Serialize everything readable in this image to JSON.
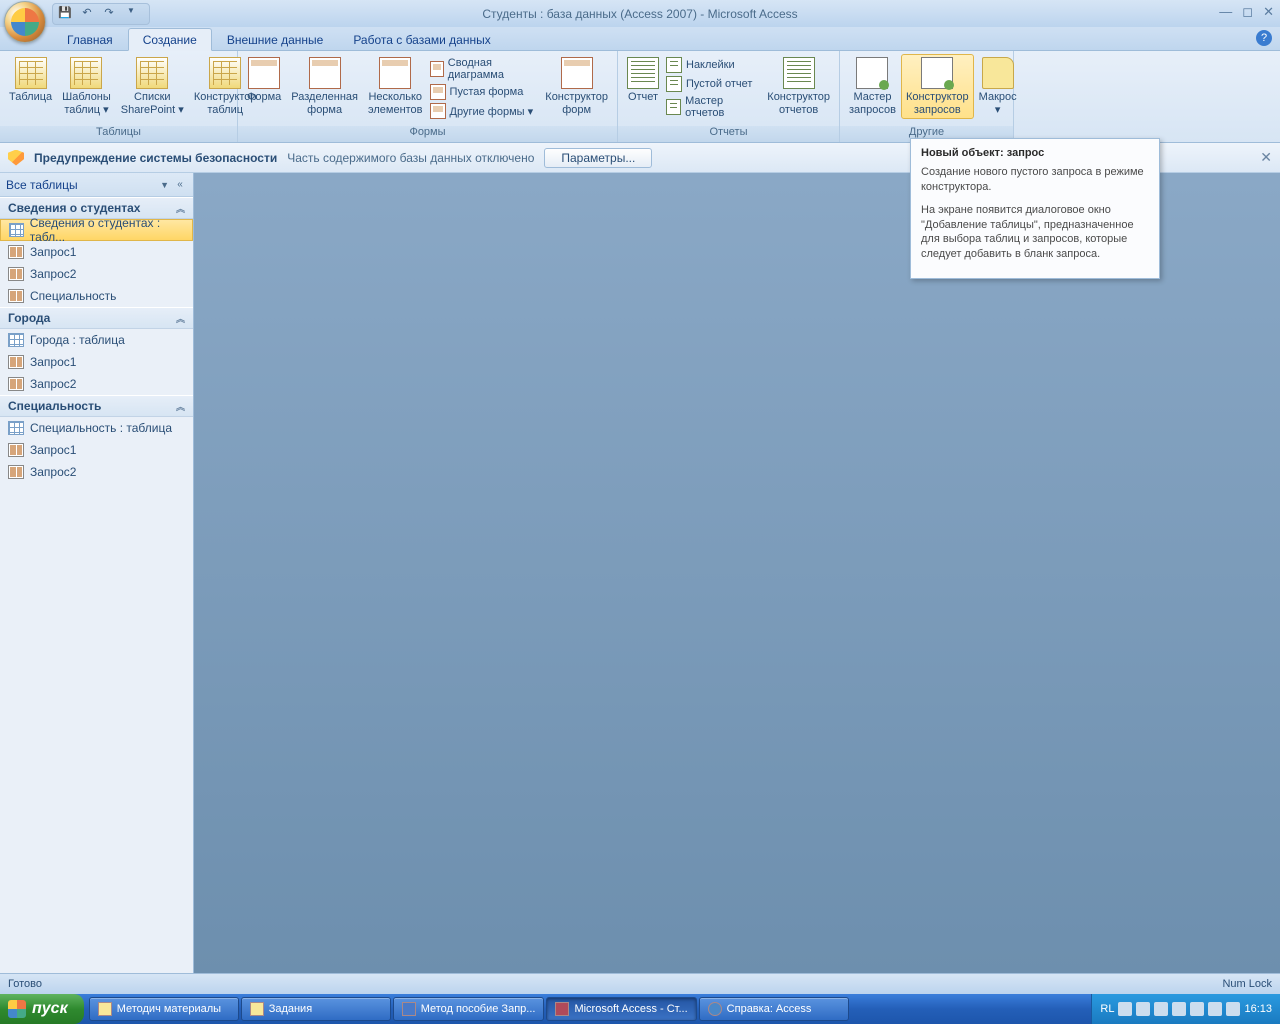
{
  "title": "Студенты : база данных (Access 2007) - Microsoft Access",
  "tabs": [
    "Главная",
    "Создание",
    "Внешние данные",
    "Работа с базами данных"
  ],
  "activeTab": 1,
  "ribbon": {
    "groups": [
      {
        "label": "Таблицы",
        "buttons": [
          "Таблица",
          "Шаблоны\nтаблиц ▾",
          "Списки\nSharePoint ▾",
          "Конструктор\nтаблиц"
        ]
      },
      {
        "label": "Формы",
        "buttons": [
          "Форма",
          "Разделенная\nформа",
          "Несколько\nэлементов"
        ],
        "small": [
          "Сводная диаграмма",
          "Пустая форма",
          "Другие формы ▾"
        ],
        "trail": [
          "Конструктор\nформ"
        ]
      },
      {
        "label": "Отчеты",
        "buttons": [
          "Отчет"
        ],
        "small": [
          "Наклейки",
          "Пустой отчет",
          "Мастер отчетов"
        ],
        "trail": [
          "Конструктор\nотчетов"
        ]
      },
      {
        "label": "Другие",
        "buttons": [
          "Мастер\nзапросов",
          "Конструктор\nзапросов",
          "Макрос\n▾"
        ]
      }
    ]
  },
  "security": {
    "title": "Предупреждение системы безопасности",
    "msg": "Часть содержимого базы данных отключено",
    "btn": "Параметры..."
  },
  "nav": {
    "header": "Все таблицы",
    "groups": [
      {
        "title": "Сведения о студентах",
        "items": [
          {
            "t": "tbl",
            "label": "Сведения о студентах : табл...",
            "sel": true
          },
          {
            "t": "qry",
            "label": "Запрос1"
          },
          {
            "t": "qry",
            "label": "Запрос2"
          },
          {
            "t": "qry",
            "label": "Специальность"
          }
        ]
      },
      {
        "title": "Города",
        "items": [
          {
            "t": "tbl",
            "label": "Города : таблица"
          },
          {
            "t": "qry",
            "label": "Запрос1"
          },
          {
            "t": "qry",
            "label": "Запрос2"
          }
        ]
      },
      {
        "title": "Специальность",
        "items": [
          {
            "t": "tbl",
            "label": "Специальность : таблица"
          },
          {
            "t": "qry",
            "label": "Запрос1"
          },
          {
            "t": "qry",
            "label": "Запрос2"
          }
        ]
      }
    ]
  },
  "tooltip": {
    "title": "Новый объект: запрос",
    "p1": "Создание нового пустого запроса в режиме конструктора.",
    "p2": "На экране появится диалоговое окно \"Добавление таблицы\", предназначенное для выбора таблиц и запросов, которые следует добавить в бланк запроса."
  },
  "status": {
    "left": "Готово",
    "right": "Num Lock"
  },
  "taskbar": {
    "start": "пуск",
    "buttons": [
      {
        "ico": "folder",
        "label": "Методич материалы"
      },
      {
        "ico": "folder",
        "label": "Задания"
      },
      {
        "ico": "word",
        "label": "Метод пособие Запр..."
      },
      {
        "ico": "acc",
        "label": "Microsoft Access - Ст...",
        "pressed": true
      },
      {
        "ico": "help",
        "label": "Справка: Access"
      }
    ],
    "lang": "RL",
    "clock": "16:13"
  }
}
